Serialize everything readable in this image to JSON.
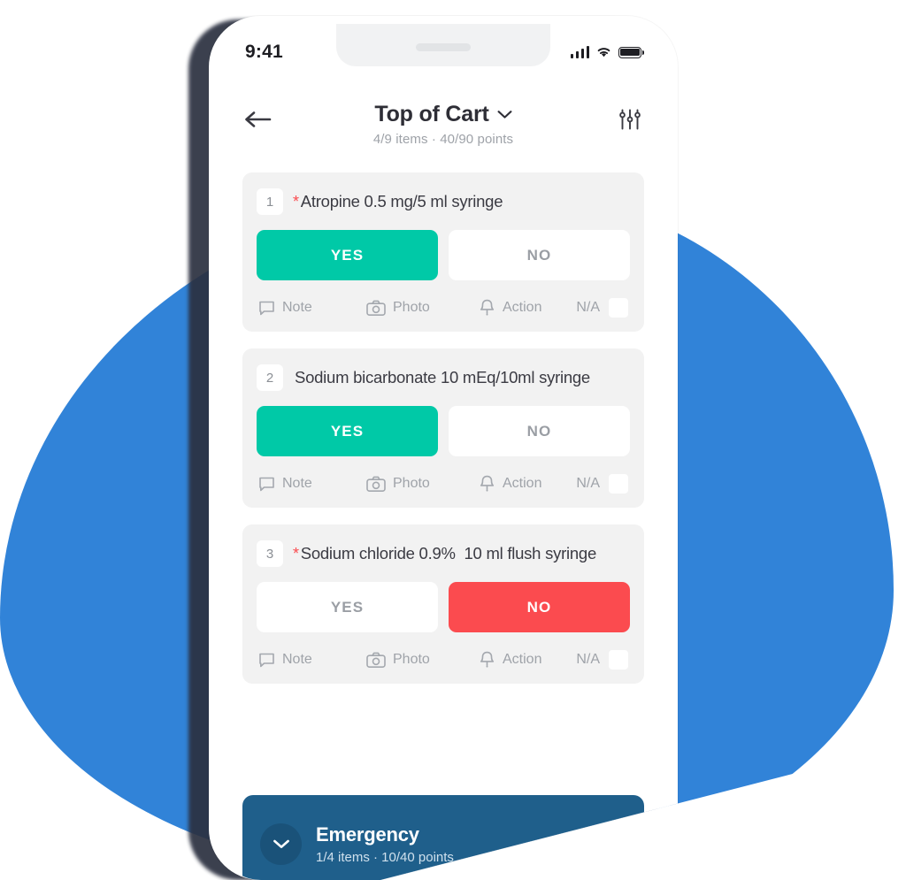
{
  "status_bar": {
    "time": "9:41",
    "signal_icon": "cellular-bars-icon",
    "wifi_icon": "wifi-icon",
    "battery_icon": "battery-full-icon"
  },
  "nav": {
    "back_icon": "back-arrow-icon",
    "title": "Top of Cart",
    "chevron_icon": "chevron-down-icon",
    "subtitle": "4/9 items · 40/90 points",
    "filter_icon": "sliders-filter-icon"
  },
  "footer_labels": {
    "note": "Note",
    "photo": "Photo",
    "action": "Action",
    "na": "N/A",
    "note_icon": "speech-bubble-icon",
    "photo_icon": "camera-icon",
    "action_icon": "bell-icon",
    "na_checkbox": "na-checkbox"
  },
  "choice_labels": {
    "yes": "YES",
    "no": "NO"
  },
  "items": [
    {
      "number": "1",
      "required": true,
      "required_marker": "*",
      "text": "Atropine 0.5 mg/5 ml syringe",
      "answer": "yes"
    },
    {
      "number": "2",
      "required": false,
      "required_marker": "",
      "text": "Sodium bicarbonate 10 mEq/10ml syringe",
      "answer": "yes"
    },
    {
      "number": "3",
      "required": true,
      "required_marker": "*",
      "text": "Sodium chloride 0.9%  10 ml flush syringe",
      "answer": "no"
    }
  ],
  "banner": {
    "chevron_icon": "chevron-down-icon",
    "title": "Emergency",
    "subtitle": "1/4 items · 10/40 points"
  },
  "colors": {
    "accent_yes": "#00c9a7",
    "accent_no": "#fb4b4f",
    "blob_blue": "#3183d8",
    "banner_blue": "#1f5f8b",
    "card_bg": "#f2f2f2",
    "required_red": "#fa4b4f"
  }
}
